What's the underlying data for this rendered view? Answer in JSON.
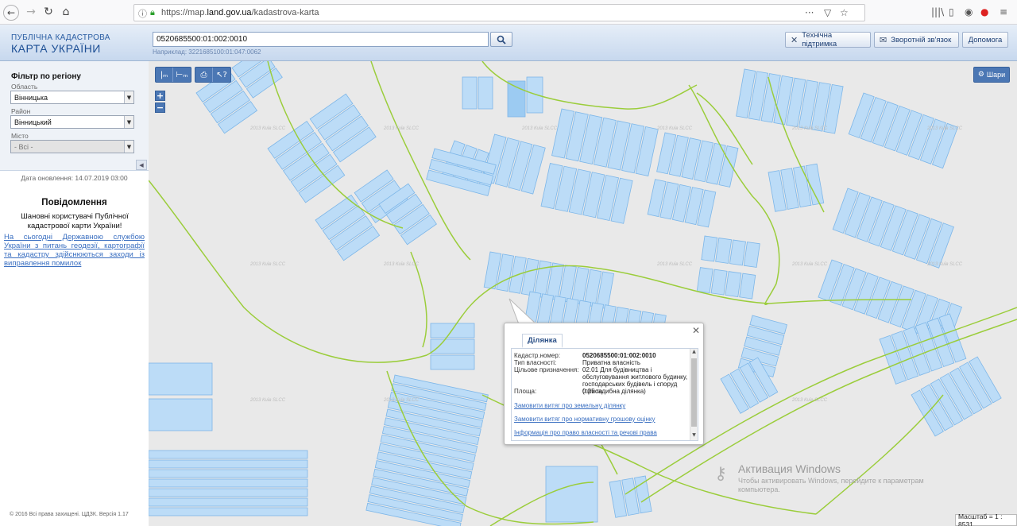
{
  "browser": {
    "url_prefix": "https://map.",
    "url_domain": "land.gov.ua",
    "url_path": "/kadastrova-karta"
  },
  "header": {
    "brand_line1": "ПУБЛІЧНА КАДАСТРОВА",
    "brand_line2": "КАРТА УКРАЇНИ",
    "search_value": "0520685500:01:002:0010",
    "search_example": "Наприклад: 3221685100:01:047:0062",
    "support_label": "Технічна підтримка",
    "feedback_label": "Зворотній зв'язок",
    "help_label": "Допомога"
  },
  "sidebar": {
    "filter_title": "Фільтр по регіону",
    "region_label": "Область",
    "region_value": "Вінницька",
    "district_label": "Район",
    "district_value": "Вінницький",
    "city_label": "Місто",
    "city_value": "- Всі -",
    "update_date": "Дата оновлення: 14.07.2019 03:00",
    "notice_title": "Повідомлення",
    "notice_greeting": "Шановні користувачі Публічної кадастрової карти України!",
    "notice_link": "На сьогодні Державною службою України з питань геодезії, картографії та кадастру здійснюються заходи із виправлення помилок",
    "footer": "© 2016 Всі права захищені. ЦДЗК. Версія 1.17"
  },
  "map": {
    "layers_label": "Шари",
    "watermark": "2013 Київ SLCC",
    "scale_label": "Масштаб = 1 : 8531",
    "popup": {
      "tab": "Ділянка",
      "cad_label": "Кадастр.номер:",
      "cad_value": "0520685500:01:002:0010",
      "own_label": "Тип власності:",
      "own_value": "Приватна власність",
      "purpose_label": "Цільове призначення:",
      "purpose_value": "02.01 Для будівництва і обслуговування житлового будинку, господарських будівель і споруд (присадибна ділянка)",
      "area_label": "Площа:",
      "area_value": "0.25 га",
      "link1": "Замовити витяг про земельну ділянку",
      "link2": "Замовити витяг про нормативну грошову оцінку",
      "link3": "Інформація про право власності та речові права"
    },
    "windows_title": "Активация Windows",
    "windows_sub": "Чтобы активировать Windows, перейдите к параметрам компьютера."
  }
}
